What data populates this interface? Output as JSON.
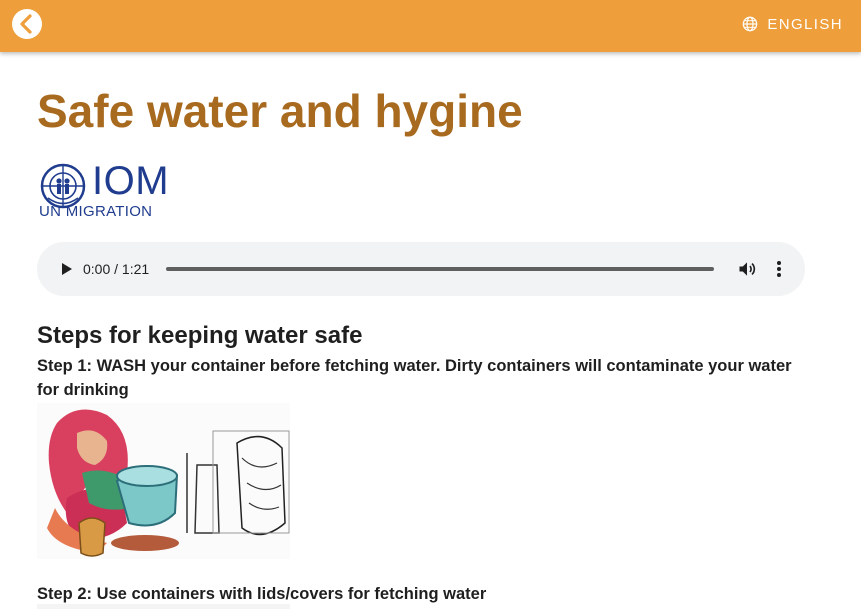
{
  "header": {
    "back_icon": "chevron-left-icon",
    "language_icon": "globe-icon",
    "language_label": "ENGLISH"
  },
  "page": {
    "title": "Safe water and hygine"
  },
  "logo": {
    "name": "IOM",
    "subtitle": "UN MIGRATION"
  },
  "audio": {
    "time": "0:00 / 1:21",
    "progress_fraction": 0,
    "icons": [
      "play-icon",
      "volume-icon",
      "more-vert-icon"
    ]
  },
  "content": {
    "heading": "Steps for keeping water safe",
    "step1": "Step 1: WASH your container before fetching water. Dirty containers will contaminate your water for drinking",
    "step2": "Step 2: Use containers with lids/covers for fetching water"
  },
  "colors": {
    "header_bg": "#ee9e3a",
    "title": "#a86a1e",
    "logo_blue": "#1f3c8e",
    "player_bg": "#f1f3f4"
  }
}
